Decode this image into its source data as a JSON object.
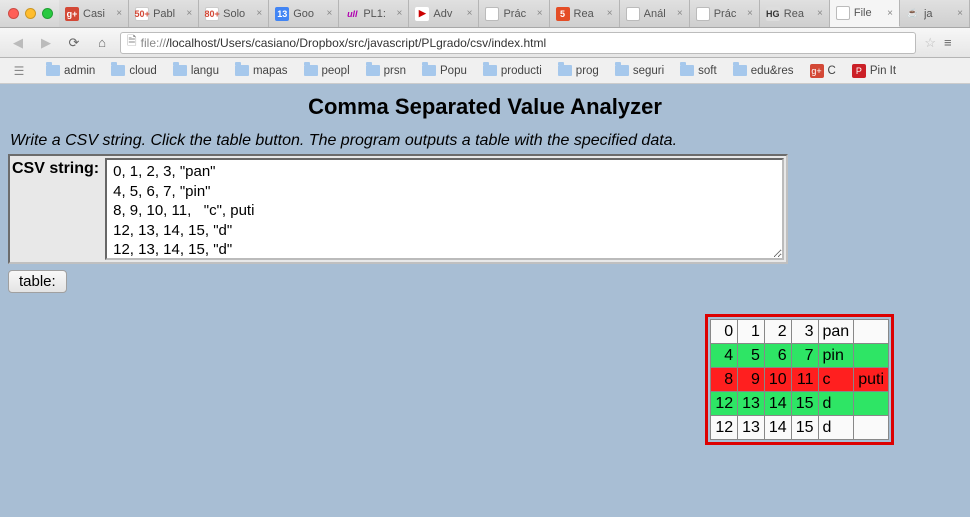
{
  "traffic_lights": {
    "close": "close",
    "min": "minimize",
    "max": "zoom"
  },
  "tabs": [
    {
      "label": "Casi",
      "favclass": "fav-gplus",
      "favtext": "g+"
    },
    {
      "label": "Pabl",
      "favclass": "fav-gmail",
      "favtext": "50+"
    },
    {
      "label": "Solo",
      "favclass": "fav-gmail",
      "favtext": "80+"
    },
    {
      "label": "Goo",
      "favclass": "fav-google",
      "favtext": "13"
    },
    {
      "label": "PL1:",
      "favclass": "fav-ull",
      "favtext": "ull"
    },
    {
      "label": "Adv",
      "favclass": "fav-yt",
      "favtext": "▶"
    },
    {
      "label": "Prác",
      "favclass": "fav-page",
      "favtext": ""
    },
    {
      "label": "Rea",
      "favclass": "fav-html5",
      "favtext": "5"
    },
    {
      "label": "Anál",
      "favclass": "fav-page",
      "favtext": ""
    },
    {
      "label": "Prác",
      "favclass": "fav-page",
      "favtext": ""
    },
    {
      "label": "Rea",
      "favclass": "fav-hg",
      "favtext": "HG"
    },
    {
      "label": "File",
      "favclass": "fav-page",
      "favtext": "",
      "active": true
    },
    {
      "label": "ja",
      "favclass": "fav-java",
      "favtext": "☕"
    }
  ],
  "urlbar": {
    "prefix": "file://",
    "path": "/localhost/Users/casiano/Dropbox/src/javascript/PLgrado/csv/index.html"
  },
  "bookmarks": [
    {
      "label": "",
      "type": "stack"
    },
    {
      "label": "admin",
      "type": "folder"
    },
    {
      "label": "cloud",
      "type": "folder"
    },
    {
      "label": "langu",
      "type": "folder"
    },
    {
      "label": "mapas",
      "type": "folder"
    },
    {
      "label": "peopl",
      "type": "folder"
    },
    {
      "label": "prsn",
      "type": "folder"
    },
    {
      "label": "Popu",
      "type": "folder"
    },
    {
      "label": "producti",
      "type": "folder"
    },
    {
      "label": "prog",
      "type": "folder"
    },
    {
      "label": "seguri",
      "type": "folder"
    },
    {
      "label": "soft",
      "type": "folder"
    },
    {
      "label": "edu&res",
      "type": "folder"
    },
    {
      "label": "C",
      "type": "gplus"
    },
    {
      "label": "Pin It",
      "type": "pin"
    }
  ],
  "page": {
    "title": "Comma Separated Value Analyzer",
    "instruction": "Write a CSV string. Click the table button. The program outputs a table with the specified data.",
    "form_label": "CSV string:",
    "textarea": "0, 1, 2, 3, \"pan\"\n4, 5, 6, 7, \"pin\"\n8, 9, 10, 11,   \"c\", puti\n12, 13, 14, 15, \"d\"\n12, 13, 14, 15, \"d\"",
    "button_label": "table:"
  },
  "output": {
    "rows": [
      {
        "class": "row-white",
        "cells": [
          "0",
          "1",
          "2",
          "3",
          "pan",
          ""
        ]
      },
      {
        "class": "row-green",
        "cells": [
          "4",
          "5",
          "6",
          "7",
          "pin",
          ""
        ]
      },
      {
        "class": "row-red",
        "cells": [
          "8",
          "9",
          "10",
          "11",
          "c",
          "puti"
        ]
      },
      {
        "class": "row-green",
        "cells": [
          "12",
          "13",
          "14",
          "15",
          "d",
          ""
        ]
      },
      {
        "class": "row-white",
        "cells": [
          "12",
          "13",
          "14",
          "15",
          "d",
          ""
        ]
      }
    ]
  }
}
